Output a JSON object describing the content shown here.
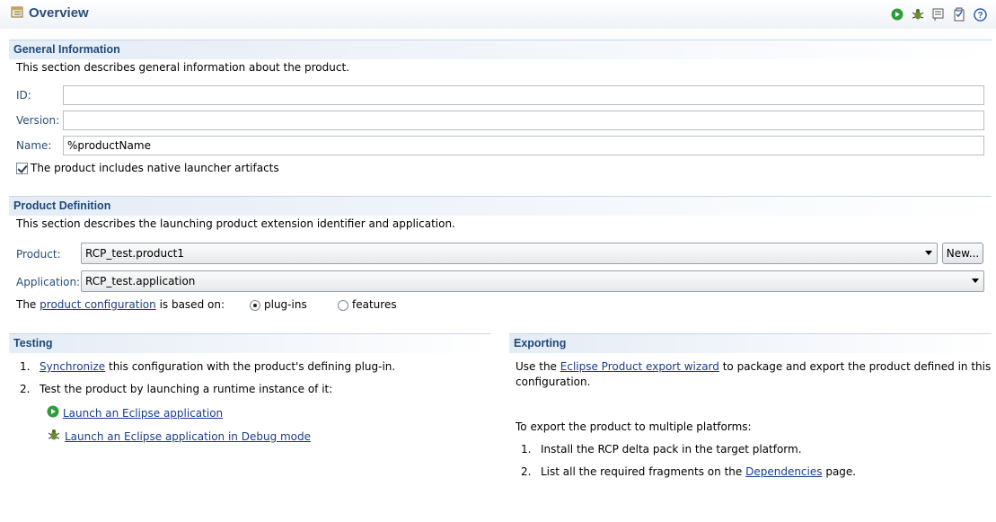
{
  "header": {
    "title": "Overview"
  },
  "toolbar": {
    "icons": [
      "run-icon",
      "debug-icon",
      "export-icon",
      "sync-icon",
      "help-icon"
    ]
  },
  "general": {
    "title": "General Information",
    "description": "This section describes general information about the product.",
    "id_label": "ID:",
    "id_value": "",
    "version_label": "Version:",
    "version_value": "",
    "name_label": "Name:",
    "name_value": "%productName",
    "launcher_checkbox_label": "The product includes native launcher artifacts",
    "launcher_checked": true
  },
  "definition": {
    "title": "Product Definition",
    "description": "This section describes the launching product extension identifier and application.",
    "product_label": "Product:",
    "product_value": "RCP_test.product1",
    "new_button": "New...",
    "application_label": "Application:",
    "application_value": "RCP_test.application",
    "based_prefix": "The",
    "based_link": "product configuration",
    "based_suffix": "is based on:",
    "radio_plugins": "plug-ins",
    "radio_features": "features",
    "selected": "plug-ins"
  },
  "testing": {
    "title": "Testing",
    "step1_num": "1.",
    "step1_link": "Synchronize",
    "step1_text": "this configuration with the product's defining plug-in.",
    "step2_num": "2.",
    "step2_text": "Test the product by launching a runtime instance of it:",
    "launch_link": "Launch an Eclipse application",
    "debug_link": "Launch an Eclipse application in Debug mode"
  },
  "exporting": {
    "title": "Exporting",
    "use_prefix": "Use the",
    "wizard_link": "Eclipse Product export wizard",
    "use_suffix": "to package and export the product defined in this",
    "use_line2": "configuration.",
    "multi_text": "To export the product to multiple platforms:",
    "step1_num": "1.",
    "step1_text": "Install the RCP delta pack in the target platform.",
    "step2_num": "2.",
    "step2_prefix": "List all the required fragments on the",
    "dependencies_link": "Dependencies",
    "step2_suffix": "page."
  }
}
